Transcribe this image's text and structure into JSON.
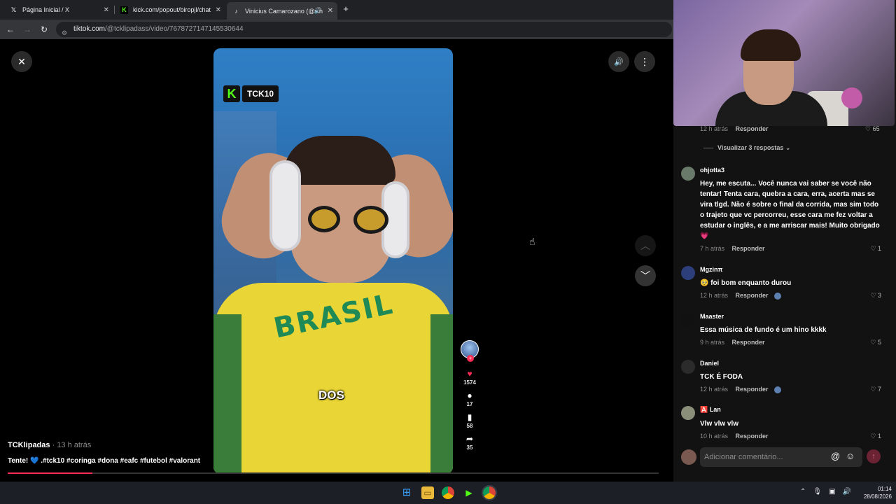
{
  "browser": {
    "tabs": [
      {
        "label": "Página Inicial / X",
        "icon": "x-logo-icon"
      },
      {
        "label": "kick.com/popout/biropjl/chat",
        "icon": "kick-logo-icon"
      },
      {
        "label": "Vinicius Camarozano (@vin",
        "icon": "tiktok-logo-icon"
      }
    ],
    "url_host": "tiktok.com",
    "url_path": "/@tcklipadass/video/7678727147145530644"
  },
  "video": {
    "logo_text": "TCK10",
    "caption": "DOS",
    "author": "TCKlipadas",
    "time": " · 13 h atrás",
    "description": "Tente! 💙 .#tck10 #coringa #dona #eafc #futebol #valorant",
    "progress_percent": 13
  },
  "actions": {
    "likes": "1574",
    "comments": "17",
    "saves": "58",
    "shares": "35"
  },
  "comments_panel": {
    "top_time": "12 h atrás",
    "reply_label": "Responder",
    "top_likes": "65",
    "view_replies": "Visualizar 3 respostas",
    "comments": [
      {
        "user": "ohjotta3",
        "text": "Hey, me escuta... Você nunca vai saber se você não tentar! Tenta cara, quebra a cara, erra, acerta mas se vira tlgd. Não é sobre o final da corrida, mas sim todo o trajeto que vc percorreu, esse cara me fez voltar a estudar o inglês, e a me arriscar mais! Muito obrigado 💗",
        "time": "7 h atrás",
        "likes": "1"
      },
      {
        "user": "Mgzinπ",
        "text": "🥺 foi bom enquanto durou",
        "time": "12 h atrás",
        "likes": "3"
      },
      {
        "user": "Maaster",
        "text": "Essa música de fundo é um hino kkkk",
        "time": "9 h atrás",
        "likes": "5"
      },
      {
        "user": "Daniel",
        "text": "TCK É FODA",
        "time": "12 h atrás",
        "likes": "7"
      },
      {
        "user": "🅰️ Lan",
        "text": "Vlw vlw vlw",
        "time": "10 h atrás",
        "likes": "1"
      }
    ],
    "input_placeholder": "Adicionar comentário..."
  },
  "taskbar": {
    "time": "01:14",
    "date": "28/08/2026"
  },
  "colors": {
    "accent": "#fe2c55",
    "kick_green": "#53fc18"
  }
}
